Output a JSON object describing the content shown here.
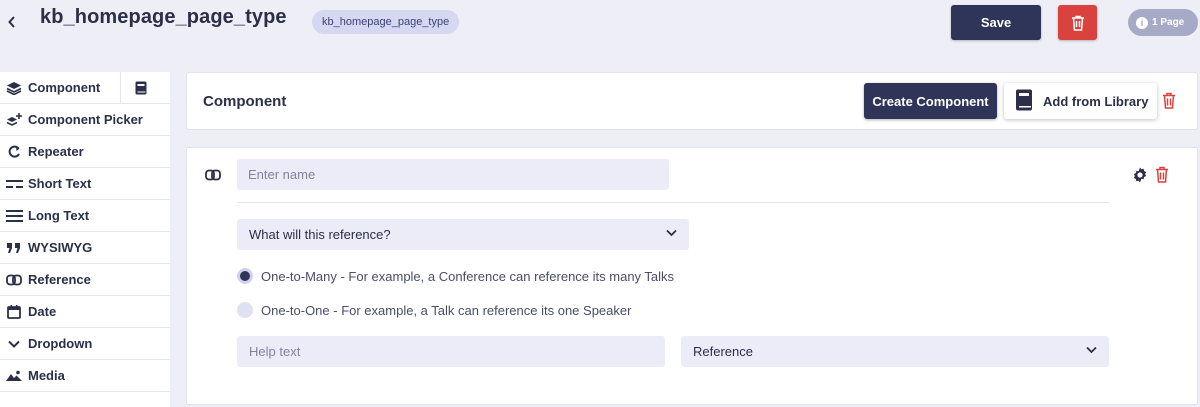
{
  "header": {
    "back_glyph": "‹",
    "title": "kb_homepage_page_type",
    "badge": "kb_homepage_page_type",
    "save_label": "Save",
    "pages_label": "1 Page",
    "info_glyph": "i"
  },
  "sidebar": {
    "items": [
      {
        "label": "Component",
        "icon": "layers-icon"
      },
      {
        "label": "Component Picker",
        "icon": "layers-plus-icon"
      },
      {
        "label": "Repeater",
        "icon": "repeat-icon"
      },
      {
        "label": "Short Text",
        "icon": "short-text-icon"
      },
      {
        "label": "Long Text",
        "icon": "long-text-icon"
      },
      {
        "label": "WYSIWYG",
        "icon": "quote-icon"
      },
      {
        "label": "Reference",
        "icon": "link-icon"
      },
      {
        "label": "Date",
        "icon": "calendar-icon"
      },
      {
        "label": "Dropdown",
        "icon": "chevron-down-icon"
      },
      {
        "label": "Media",
        "icon": "image-icon"
      }
    ]
  },
  "component_header": {
    "title": "Component",
    "create_label": "Create Component",
    "library_label": "Add from Library"
  },
  "field": {
    "name_placeholder": "Enter name",
    "reference_select": "What will this reference?",
    "options": [
      {
        "label": "One-to-Many - For example, a Conference can reference its many Talks",
        "selected": true
      },
      {
        "label": "One-to-One - For example, a Talk can reference its one Speaker",
        "selected": false
      }
    ],
    "help_placeholder": "Help text",
    "type_select": "Reference"
  },
  "colors": {
    "primary": "#2e3558",
    "danger": "#d9423d",
    "background": "#eeeef6",
    "input_bg": "#ebecf8"
  }
}
